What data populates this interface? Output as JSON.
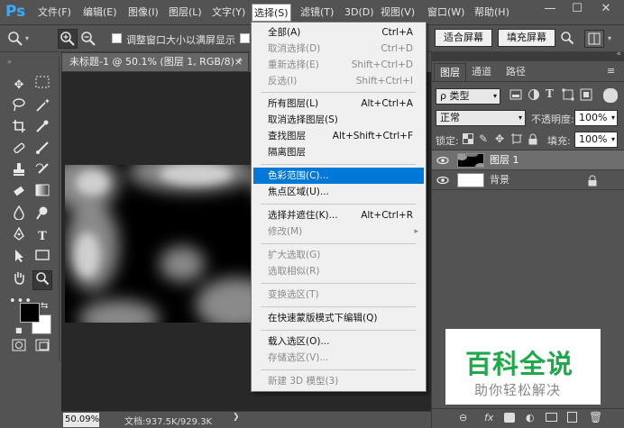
{
  "app": {
    "logo": "Ps"
  },
  "menubar": {
    "items": [
      "文件(F)",
      "编辑(E)",
      "图像(I)",
      "图层(L)",
      "文字(Y)",
      "选择(S)",
      "滤镜(T)",
      "3D(D)",
      "视图(V)",
      "窗口(W)",
      "帮助(H)"
    ],
    "active": "选择(S)"
  },
  "window_controls": {
    "minimize": "—",
    "maximize": "☐",
    "close": "✕"
  },
  "options_bar": {
    "checkbox1_label": "调整窗口大小以满屏显示",
    "fit_screen_label": "适合屏幕",
    "fill_screen_label": "填充屏幕"
  },
  "document": {
    "tab_title": "未标题-1 @ 50.1% (图层 1, RGB/8) *",
    "tab_close": "×",
    "zoom": "50.09%",
    "doc_info": "文档:937.5K/929.3K"
  },
  "select_menu": {
    "items": [
      {
        "label": "全部(A)",
        "shortcut": "Ctrl+A",
        "disabled": false
      },
      {
        "label": "取消选择(D)",
        "shortcut": "Ctrl+D",
        "disabled": true
      },
      {
        "label": "重新选择(E)",
        "shortcut": "Shift+Ctrl+D",
        "disabled": true
      },
      {
        "label": "反选(I)",
        "shortcut": "Shift+Ctrl+I",
        "disabled": true
      },
      {
        "label": "所有图层(L)",
        "shortcut": "Alt+Ctrl+A",
        "disabled": false
      },
      {
        "label": "取消选择图层(S)",
        "shortcut": "",
        "disabled": false
      },
      {
        "label": "查找图层",
        "shortcut": "Alt+Shift+Ctrl+F",
        "disabled": false
      },
      {
        "label": "隔离图层",
        "shortcut": "",
        "disabled": false
      },
      {
        "label": "色彩范围(C)...",
        "shortcut": "",
        "disabled": false,
        "highlighted": true
      },
      {
        "label": "焦点区域(U)...",
        "shortcut": "",
        "disabled": false
      },
      {
        "label": "选择并遮住(K)...",
        "shortcut": "Alt+Ctrl+R",
        "disabled": false
      },
      {
        "label": "修改(M)",
        "shortcut": "",
        "disabled": true,
        "submenu": true
      },
      {
        "label": "扩大选取(G)",
        "shortcut": "",
        "disabled": true
      },
      {
        "label": "选取相似(R)",
        "shortcut": "",
        "disabled": true
      },
      {
        "label": "变换选区(T)",
        "shortcut": "",
        "disabled": true
      },
      {
        "label": "在快速蒙版模式下编辑(Q)",
        "shortcut": "",
        "disabled": false
      },
      {
        "label": "载入选区(O)...",
        "shortcut": "",
        "disabled": false
      },
      {
        "label": "存储选区(V)...",
        "shortcut": "",
        "disabled": true
      },
      {
        "label": "新建 3D 模型(3)",
        "shortcut": "",
        "disabled": true
      }
    ],
    "submenu_arrow": "▸"
  },
  "panel": {
    "tabs": [
      "图层",
      "通道",
      "路径"
    ],
    "active_tab": "图层",
    "filter_kind": "ρ 类型",
    "blend_mode": "正常",
    "opacity_label": "不透明度:",
    "opacity_value": "100%",
    "lock_label": "锁定:",
    "fill_label": "填充:",
    "fill_value": "100%",
    "layers": [
      {
        "name": "图层 1",
        "selected": true
      },
      {
        "name": "背景",
        "selected": false,
        "locked": true
      }
    ]
  },
  "watermark": {
    "title": "百科全说",
    "subtitle": "助你轻松解决",
    "title_color": "#1fa84a",
    "subtitle_color": "#888888"
  },
  "colors": {
    "foreground": "#000000",
    "background": "#ffffff",
    "highlight": "#0078d7",
    "ps_logo": "#3fa8f4"
  }
}
